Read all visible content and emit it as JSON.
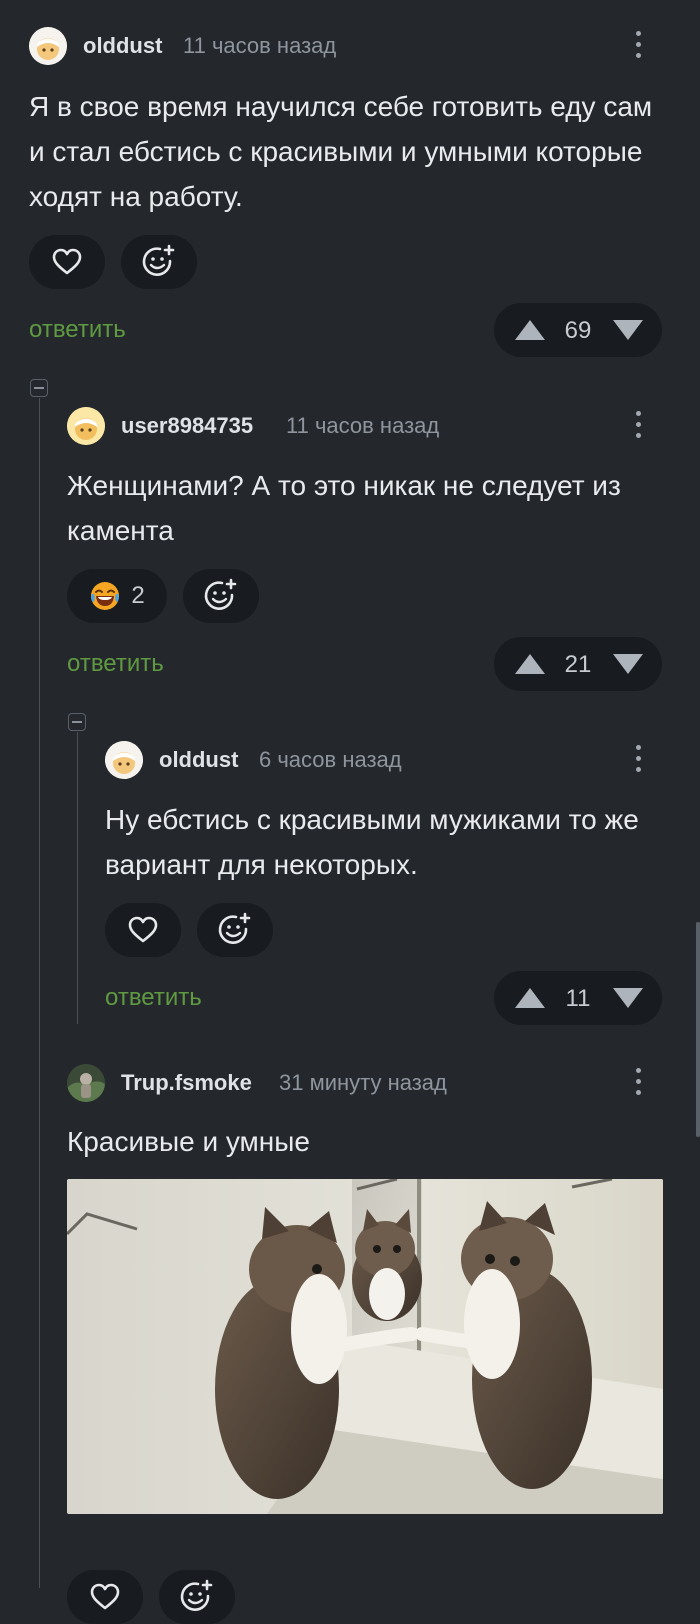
{
  "comments": [
    {
      "author": "olddust",
      "time": "11 часов назад",
      "text": "Я в свое время научился себе готовить еду сам и стал ебстись с красивыми и умными которые ходят на работу.",
      "reply_label": "ответить",
      "score": "69",
      "reactions": [
        {
          "icon": "heart-icon"
        },
        {
          "icon": "add-reaction-icon"
        }
      ]
    },
    {
      "author": "user8984735",
      "time": "11 часов назад",
      "text": "Женщинами? А то это никак не следует из камента",
      "reply_label": "ответить",
      "score": "21",
      "reactions": [
        {
          "icon": "laughing-emoji-icon",
          "count": "2"
        },
        {
          "icon": "add-reaction-icon"
        }
      ]
    },
    {
      "author": "olddust",
      "time": "6 часов назад",
      "text": "Ну ебстись с красивыми мужиками то же вариант для некоторых.",
      "reply_label": "ответить",
      "score": "11",
      "reactions": [
        {
          "icon": "heart-icon"
        },
        {
          "icon": "add-reaction-icon"
        }
      ]
    },
    {
      "author": "Trup.fsmoke",
      "time": "31 минуту назад",
      "text": "Красивые и умные",
      "image": "cat-looking-in-mirror-image"
    }
  ],
  "colors": {
    "background": "#24282d",
    "pill": "#181b1f",
    "reply_link": "#5f9a41",
    "muted_text": "#8f959d"
  }
}
